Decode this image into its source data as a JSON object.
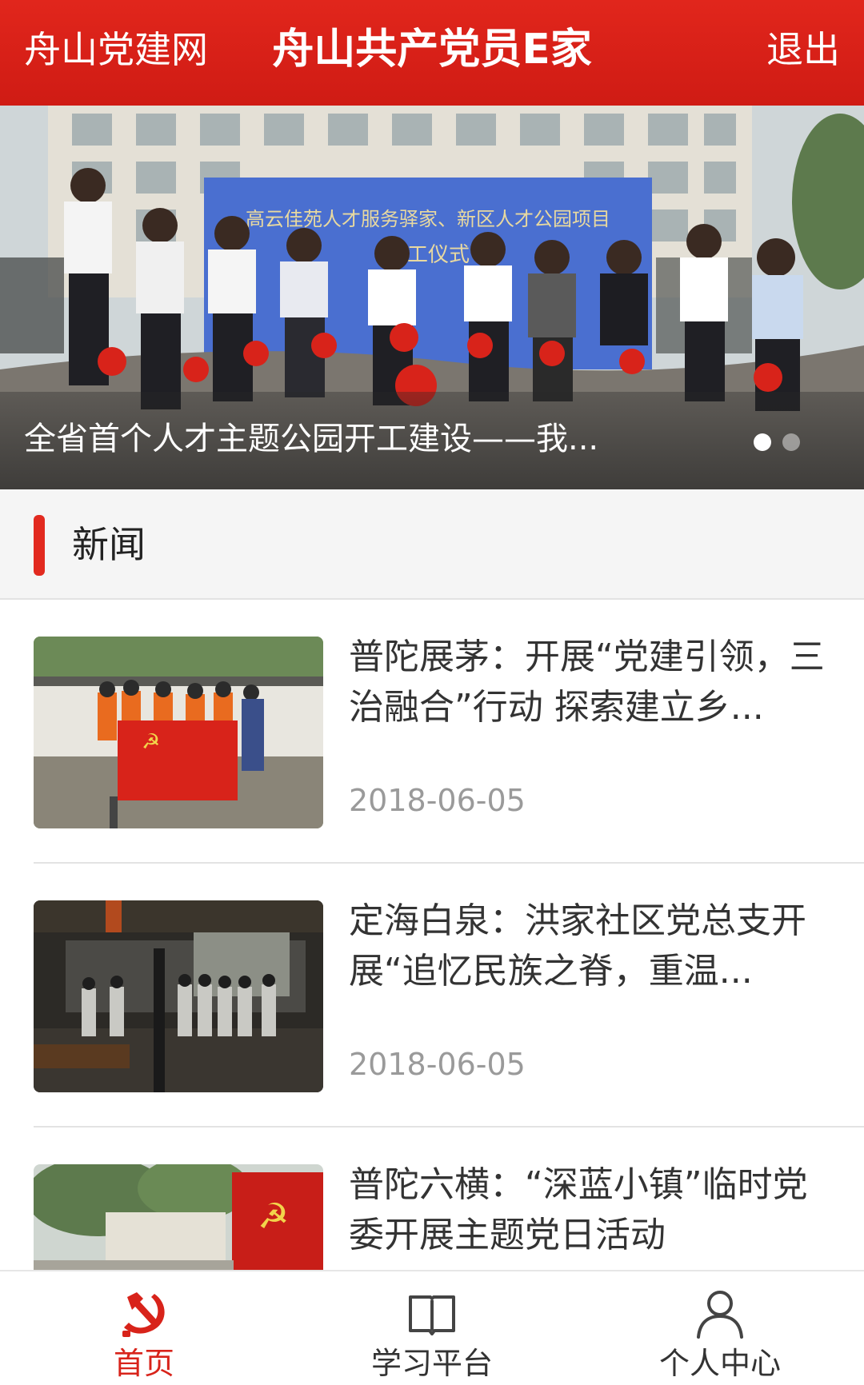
{
  "header": {
    "left_link": "舟山党建网",
    "title": "舟山共产党员E家",
    "logout": "退出"
  },
  "banner": {
    "caption": "全省首个人才主题公园开工建设——我...",
    "sign_text": "高云佳苑人才服务驿家、新区人才公园项目",
    "sign_subtext": "开工仪式",
    "active_dot": 1,
    "dot_count": 2
  },
  "section": {
    "title": "新闻"
  },
  "news": [
    {
      "title": "普陀展茅：开展“党建引领，三治融合”行动 探索建立乡...",
      "date": "2018-06-05",
      "thumb_icon": "volunteer-group-photo"
    },
    {
      "title": "定海白泉：洪家社区党总支开展“追忆民族之脊，重温...",
      "date": "2018-06-05",
      "thumb_icon": "memorial-hall-visit-photo"
    },
    {
      "title": "普陀六横：“深蓝小镇”临时党委开展主题党日活动",
      "date": "",
      "thumb_icon": "party-flag-wall-photo"
    }
  ],
  "tabbar": {
    "items": [
      {
        "label": "首页",
        "icon": "hammer-sickle-icon",
        "active": true
      },
      {
        "label": "学习平台",
        "icon": "book-icon",
        "active": false
      },
      {
        "label": "个人中心",
        "icon": "person-icon",
        "active": false
      }
    ]
  },
  "colors": {
    "primary_red": "#d8231a",
    "date_gray": "#9a9a9a"
  }
}
